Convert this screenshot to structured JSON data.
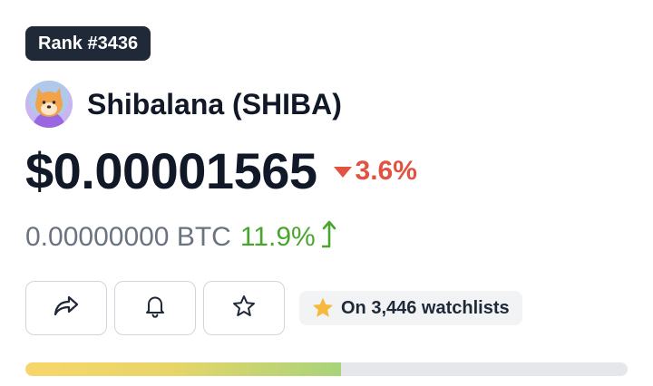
{
  "rank": {
    "label": "Rank #3436"
  },
  "coin": {
    "name": "Shibalana (SHIBA)",
    "logo_icon": "shiba-dog-logo-icon"
  },
  "price": {
    "usd": "$0.00001565",
    "change": "3.6%",
    "change_direction": "down",
    "change_color": "#e15241"
  },
  "btc": {
    "value": "0.00000000 BTC",
    "change": "11.9%",
    "change_direction": "up",
    "change_color": "#4aa52e"
  },
  "actions": {
    "share_icon": "share-icon",
    "alert_icon": "bell-icon",
    "watchlist_icon": "star-outline-icon"
  },
  "watchlist": {
    "label": "On 3,446 watchlists",
    "icon": "star-filled-icon"
  },
  "progress": {
    "fill_fraction": 0.524
  }
}
